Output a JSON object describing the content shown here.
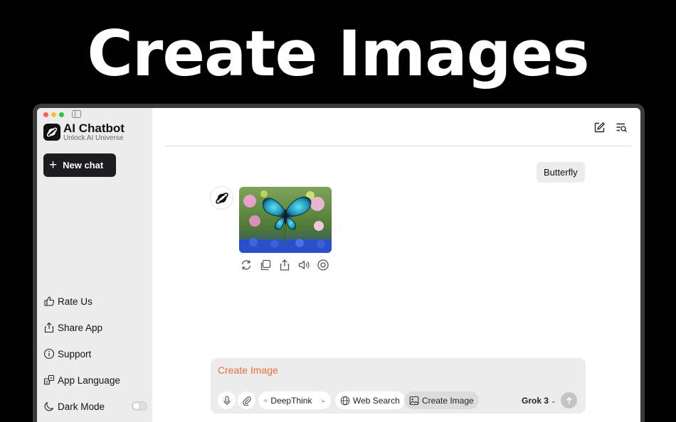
{
  "hero": {
    "title": "Create Images"
  },
  "app": {
    "name": "AI Chatbot",
    "tagline": "Unlock AI Universe"
  },
  "sidebar": {
    "new_chat_label": "New chat",
    "items": [
      {
        "label": "Rate Us",
        "icon": "thumbs-up-icon"
      },
      {
        "label": "Share App",
        "icon": "share-icon"
      },
      {
        "label": "Support",
        "icon": "info-icon"
      },
      {
        "label": "App Language",
        "icon": "translate-icon"
      },
      {
        "label": "Dark Mode",
        "icon": "moon-icon",
        "toggle": false
      }
    ]
  },
  "chat": {
    "user_message": "Butterfly",
    "bot_image": "blue butterfly on flowers",
    "actions": [
      "regenerate-icon",
      "copy-icon",
      "share-icon",
      "speaker-icon",
      "eye-icon"
    ]
  },
  "composer": {
    "value": "Create Image",
    "tools": {
      "deepthink": "DeepThink",
      "web_search": "Web Search",
      "create_image": "Create Image"
    },
    "model": "Grok 3"
  },
  "colors": {
    "accent": "#e8703a",
    "sidebar_bg": "#ececec",
    "button_dark": "#1d1d1f"
  }
}
